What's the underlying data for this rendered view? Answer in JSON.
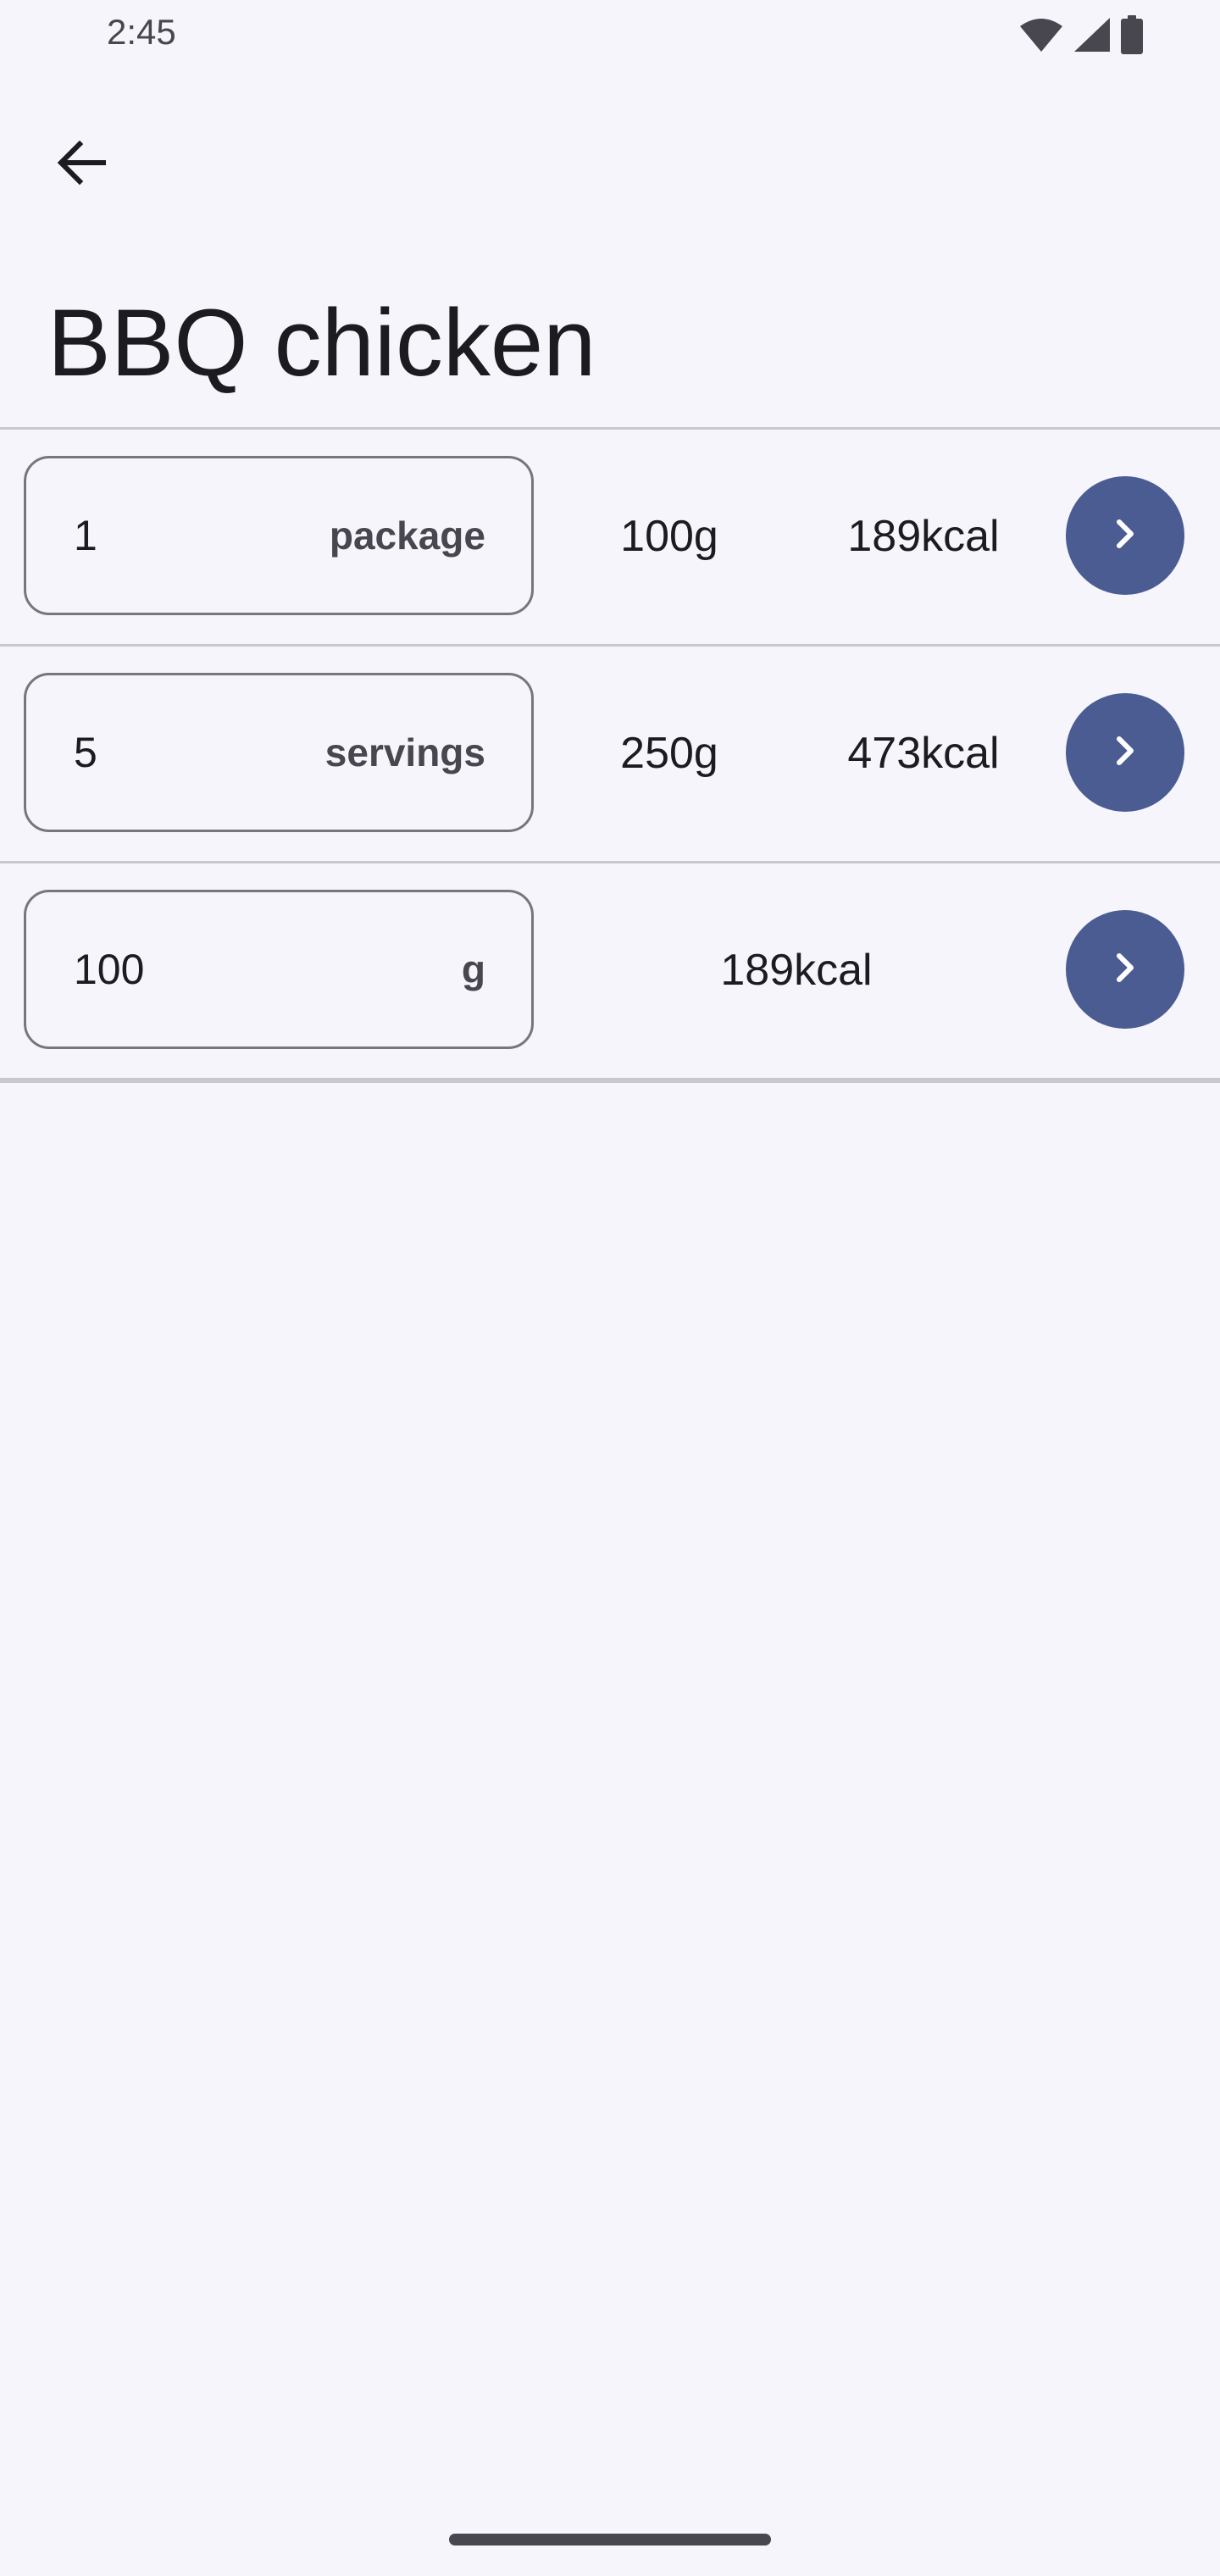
{
  "status_bar": {
    "time": "2:45",
    "icons": [
      "wifi-icon",
      "cellular-signal-icon",
      "battery-icon"
    ]
  },
  "header": {
    "back_icon": "arrow-back-icon",
    "title": "BBQ chicken"
  },
  "portions": [
    {
      "quantity": "1",
      "unit": "package",
      "weight": "100g",
      "kcal": "189kcal"
    },
    {
      "quantity": "5",
      "unit": "servings",
      "weight": "250g",
      "kcal": "473kcal"
    },
    {
      "quantity": "100",
      "unit": "g",
      "weight": "",
      "kcal": "189kcal"
    }
  ],
  "colors": {
    "background": "#f6f5fb",
    "accent": "#4a5c92",
    "text": "#1c1b1f",
    "outline": "#77757e"
  },
  "go_icon": "chevron-right-icon"
}
